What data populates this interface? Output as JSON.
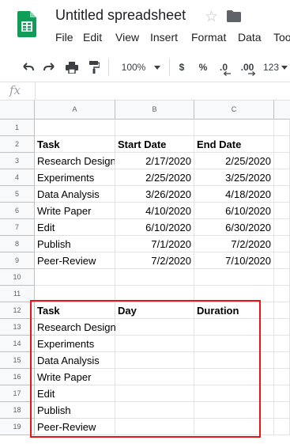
{
  "header": {
    "title": "Untitled spreadsheet",
    "menu": [
      "File",
      "Edit",
      "View",
      "Insert",
      "Format",
      "Data",
      "Too"
    ]
  },
  "toolbar": {
    "zoom": "100%",
    "currency": "$",
    "percent": "%",
    "decrease_decimal": ".0",
    "increase_decimal": ".00",
    "more_formats": "123"
  },
  "formula_bar": {
    "label": "fx",
    "value": ""
  },
  "columns": [
    "A",
    "B",
    "C"
  ],
  "rows": [
    {
      "num": "1",
      "a": "",
      "b": "",
      "c": ""
    },
    {
      "num": "2",
      "a": "Task",
      "b": "Start Date",
      "c": "End Date",
      "bold": true
    },
    {
      "num": "3",
      "a": "Research Design",
      "b": "2/17/2020",
      "c": "2/25/2020"
    },
    {
      "num": "4",
      "a": "Experiments",
      "b": "2/25/2020",
      "c": "3/25/2020"
    },
    {
      "num": "5",
      "a": "Data Analysis",
      "b": "3/26/2020",
      "c": "4/18/2020"
    },
    {
      "num": "6",
      "a": "Write Paper",
      "b": "4/10/2020",
      "c": "6/10/2020"
    },
    {
      "num": "7",
      "a": "Edit",
      "b": "6/10/2020",
      "c": "6/30/2020"
    },
    {
      "num": "8",
      "a": "Publish",
      "b": "7/1/2020",
      "c": "7/2/2020"
    },
    {
      "num": "9",
      "a": "Peer-Review",
      "b": "7/2/2020",
      "c": "7/10/2020"
    },
    {
      "num": "10",
      "a": "",
      "b": "",
      "c": ""
    },
    {
      "num": "11",
      "a": "",
      "b": "",
      "c": ""
    },
    {
      "num": "12",
      "a": "Task",
      "b": "Day",
      "c": "Duration",
      "bold": true
    },
    {
      "num": "13",
      "a": "Research Design",
      "b": "",
      "c": "",
      "overflow": true
    },
    {
      "num": "14",
      "a": "Experiments",
      "b": "",
      "c": ""
    },
    {
      "num": "15",
      "a": "Data Analysis",
      "b": "",
      "c": ""
    },
    {
      "num": "16",
      "a": "Write Paper",
      "b": "",
      "c": ""
    },
    {
      "num": "17",
      "a": "Edit",
      "b": "",
      "c": ""
    },
    {
      "num": "18",
      "a": "Publish",
      "b": "",
      "c": ""
    },
    {
      "num": "19",
      "a": "Peer-Review",
      "b": "",
      "c": ""
    }
  ],
  "colors": {
    "logo_green": "#0f9d58",
    "highlight_border": "#e8141c",
    "header_bg": "#f8f9fa"
  }
}
